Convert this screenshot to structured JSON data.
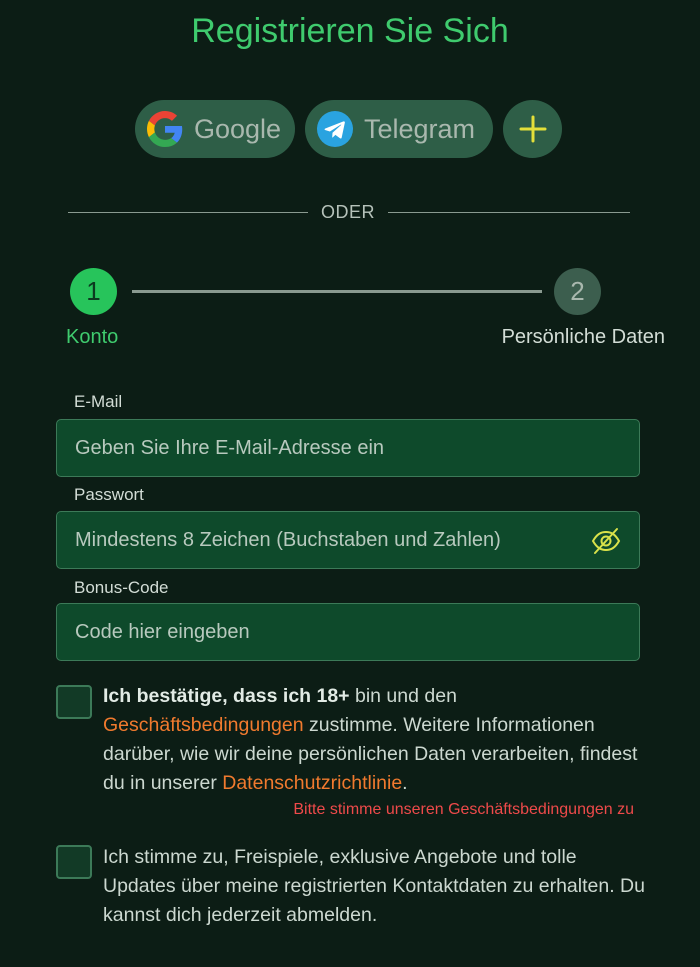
{
  "title": "Registrieren Sie Sich",
  "social": {
    "google_label": "Google",
    "telegram_label": "Telegram",
    "more_label": "+"
  },
  "divider_text": "ODER",
  "stepper": {
    "step1_number": "1",
    "step1_label": "Konto",
    "step2_number": "2",
    "step2_label": "Persönliche Daten",
    "current_step": 1
  },
  "form": {
    "email_label": "E-Mail",
    "email_placeholder": "Geben Sie Ihre E-Mail-Adresse ein",
    "password_label": "Passwort",
    "password_placeholder": "Mindestens 8 Zeichen (Buchstaben und Zahlen)",
    "bonus_label": "Bonus-Code",
    "bonus_placeholder": "Code hier eingeben"
  },
  "consent_terms": {
    "bold": "Ich bestätige, dass ich 18+",
    "text1": " bin und den ",
    "terms_link": "Geschäftsbedingungen",
    "text2": " zustimme. Weitere Informationen darüber, wie wir deine persönlichen Daten verarbeiten, findest du in unserer ",
    "privacy_link": "Datenschutzrichtlinie",
    "text3": ".",
    "checked": false,
    "error": "Bitte stimme unseren Geschäftsbedingungen zu"
  },
  "consent_marketing": {
    "text": "Ich stimme zu, Freispiele, exklusive Angebote und tolle Updates über meine registrierten Kontaktdaten zu erhalten. Du kannst dich jederzeit abmelden.",
    "checked": false
  },
  "colors": {
    "background": "#0c1d15",
    "accent_green": "#3fcb6e",
    "input_bg": "#0e4a2b",
    "link_orange": "#f07a2e",
    "error_red": "#ee4a4a"
  }
}
